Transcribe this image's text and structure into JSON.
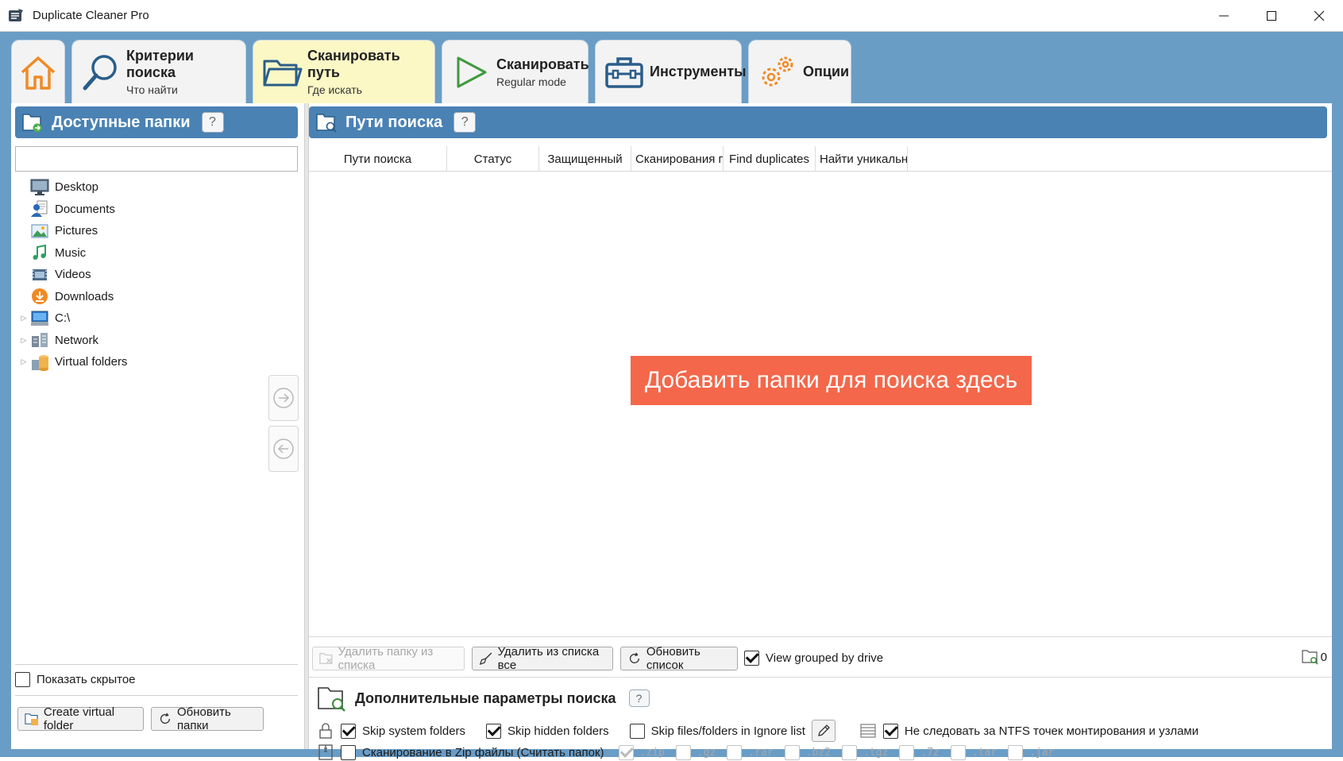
{
  "window": {
    "title": "Duplicate Cleaner Pro"
  },
  "tabs": [
    {
      "id": "home",
      "label": "",
      "sub": "",
      "icon": "home-icon"
    },
    {
      "id": "criteria",
      "label": "Критерии поиска",
      "sub": "Что найти",
      "icon": "search-icon"
    },
    {
      "id": "scan_path",
      "label": "Сканировать путь",
      "sub": "Где искать",
      "icon": "folder-icon",
      "active": true
    },
    {
      "id": "scan",
      "label": "Сканировать",
      "sub": "Regular mode",
      "icon": "play-icon"
    },
    {
      "id": "tools",
      "label": "Инструменты",
      "sub": "",
      "icon": "toolbox-icon"
    },
    {
      "id": "options",
      "label": "Опции",
      "sub": "",
      "icon": "gears-icon"
    }
  ],
  "left": {
    "header": "Доступные папки",
    "help": "?",
    "search_value": "",
    "tree": [
      {
        "label": "Desktop",
        "icon": "desktop-icon",
        "expandable": false
      },
      {
        "label": "Documents",
        "icon": "documents-icon",
        "expandable": false
      },
      {
        "label": "Pictures",
        "icon": "pictures-icon",
        "expandable": false
      },
      {
        "label": "Music",
        "icon": "music-icon",
        "expandable": false
      },
      {
        "label": "Videos",
        "icon": "videos-icon",
        "expandable": false
      },
      {
        "label": "Downloads",
        "icon": "downloads-icon",
        "expandable": false
      },
      {
        "label": "C:\\",
        "icon": "computer-icon",
        "expandable": true
      },
      {
        "label": "Network",
        "icon": "network-icon",
        "expandable": true
      },
      {
        "label": "Virtual folders",
        "icon": "virtual-folders-icon",
        "expandable": true
      }
    ],
    "show_hidden": "Показать скрытое",
    "create_virtual": "Create virtual folder",
    "refresh_folders": "Обновить папки"
  },
  "right": {
    "header": "Пути поиска",
    "help": "?",
    "columns": [
      "Пути поиска",
      "Статус",
      "Защищенный",
      "Сканирования по",
      "Find duplicates",
      "Найти уникальные"
    ],
    "drop_hint": "Добавить папки для поиска здесь",
    "remove_folder": "Удалить папку из списка",
    "remove_all": "Удалить из списка все",
    "refresh_list": "Обновить список",
    "view_grouped": "View grouped by drive",
    "folder_count": "0",
    "extra_title": "Дополнительные параметры поиска",
    "extra_help": "?",
    "skip_system": "Skip system folders",
    "skip_hidden": "Skip hidden folders",
    "skip_ignore": "Skip files/folders in Ignore list",
    "ntfs": "Не следовать за NTFS точек монтирования и узлами",
    "zip_scan": "Сканирование в Zip файлы (Считать папок)",
    "archives": [
      ".zip",
      ".gz",
      ".rar",
      ".bz2",
      ".tgz",
      ".7z",
      ".tar",
      ".jar"
    ]
  },
  "colors": {
    "frame": "#6a9dc6",
    "header": "#4a82b4",
    "active_tab": "#fbf8c6",
    "banner": "#f4674a",
    "accent_orange": "#f08a24"
  }
}
